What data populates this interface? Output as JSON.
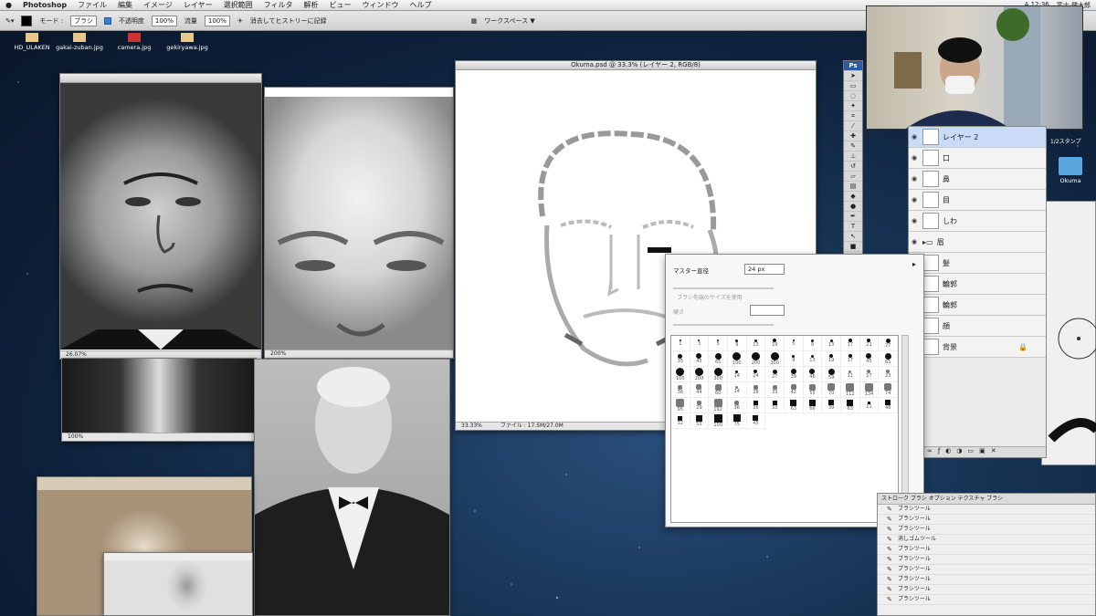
{
  "menubar": {
    "app": "Photoshop",
    "items": [
      "ファイル",
      "編集",
      "イメージ",
      "レイヤー",
      "選択範囲",
      "フィルタ",
      "解析",
      "ビュー",
      "ウィンドウ",
      "ヘルプ"
    ],
    "right": [
      "A 12:36",
      "富士 健太郎"
    ]
  },
  "options_bar": {
    "mode_label": "モード :",
    "mode_value": "ブラシ",
    "opacity_label": "不透明度",
    "opacity_value": "100%",
    "flow_label": "流量",
    "flow_value": "100%",
    "erase_label": "消去してヒストリーに記録",
    "workspace": "ワークスペース ▼"
  },
  "desktop_icons": [
    "HD_ULAKEN",
    "gakai-zuban.jpg",
    "camera.jpg",
    "gekiryawa.jpg"
  ],
  "desktop_folder": "Okuma",
  "canvas_window": {
    "title": "Okuma.psd @ 33.3% (レイヤー 2, RGB/8)",
    "status_zoom": "33.33%",
    "status_file": "ファイル : 17.5M/27.0M"
  },
  "photo_windows": [
    {
      "zoom": "26.07%"
    },
    {
      "zoom": "200%"
    },
    {
      "zoom": "100%"
    }
  ],
  "brush_panel": {
    "master_label": "マスター直径",
    "master_value": "24 px",
    "sample_label": "ブラシ先端のサイズを使用",
    "hardness_label": "硬さ",
    "brush_sizes": [
      "1",
      "3",
      "5",
      "9",
      "13",
      "19",
      "5",
      "9",
      "13",
      "17",
      "21",
      "27",
      "35",
      "45",
      "65",
      "100",
      "200",
      "300",
      "9",
      "13",
      "19",
      "17",
      "45",
      "65",
      "100",
      "200",
      "300",
      "14",
      "24",
      "27",
      "39",
      "46",
      "59",
      "11",
      "17",
      "23",
      "36",
      "44",
      "60",
      "14",
      "26",
      "33",
      "42",
      "55",
      "70",
      "112",
      "134",
      "74",
      "95",
      "29",
      "192",
      "36",
      "36",
      "33",
      "63",
      "66",
      "39",
      "63",
      "11",
      "48",
      "32",
      "55",
      "100",
      "75",
      "45"
    ]
  },
  "layers_panel": {
    "title": "レイヤー",
    "rows": [
      {
        "name": "レイヤー 2",
        "selected": true
      },
      {
        "name": "口"
      },
      {
        "name": "鼻"
      },
      {
        "name": "目"
      },
      {
        "name": "しわ"
      },
      {
        "name": "眉"
      },
      {
        "name": "髪"
      },
      {
        "name": "輪郭"
      },
      {
        "name": "輪郭"
      },
      {
        "name": "顔"
      },
      {
        "name": "背景"
      }
    ]
  },
  "tool_presets": {
    "header": "ストローク  ブラシ  オプション  テクスチャ  ブラシ",
    "items": [
      "ブラシツール",
      "ブラシツール",
      "ブラシツール",
      "消しゴムツール",
      "ブラシツール",
      "ブラシツール",
      "ブラシツール",
      "ブラシツール",
      "ブラシツール",
      "ブラシツール"
    ]
  },
  "right_panel_label": "1/2スタンプ"
}
